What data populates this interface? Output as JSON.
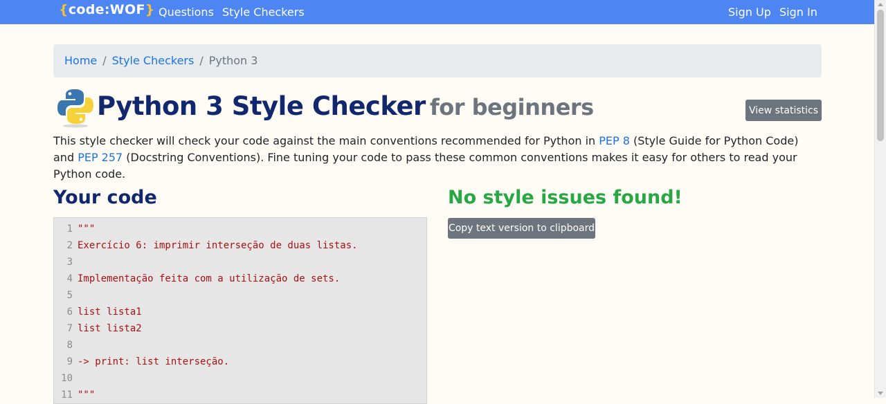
{
  "navbar": {
    "brand": {
      "open": "{",
      "name": "code:WOF",
      "close": "}"
    },
    "links": [
      "Questions",
      "Style Checkers"
    ],
    "auth": [
      "Sign Up",
      "Sign In"
    ]
  },
  "breadcrumb": {
    "home": "Home",
    "section": "Style Checkers",
    "current": "Python 3",
    "separator": "/"
  },
  "page": {
    "title": "Python 3 Style Checker",
    "subtitle": "for beginners",
    "stats_button": "View statistics",
    "intro_part1": "This style checker will check your code against the main conventions recommended for Python in ",
    "pep8_link": "PEP 8",
    "intro_part2": " (Style Guide for Python Code) and ",
    "pep257_link": "PEP 257",
    "intro_part3": " (Docstring Conventions). Fine tuning your code to pass these common conventions makes it easy for others to read your Python code."
  },
  "code_section": {
    "heading": "Your code",
    "lines": [
      {
        "n": "1",
        "text": "\"\"\""
      },
      {
        "n": "2",
        "text": "Exercício 6: imprimir interseção de duas listas."
      },
      {
        "n": "3",
        "text": ""
      },
      {
        "n": "4",
        "text": "Implementação feita com a utilização de sets."
      },
      {
        "n": "5",
        "text": ""
      },
      {
        "n": "6",
        "text": "list lista1"
      },
      {
        "n": "7",
        "text": "list lista2"
      },
      {
        "n": "8",
        "text": ""
      },
      {
        "n": "9",
        "text": "-> print: list interseção."
      },
      {
        "n": "10",
        "text": ""
      },
      {
        "n": "11",
        "text": "\"\"\""
      }
    ]
  },
  "result": {
    "heading": "No style issues found!",
    "copy_button": "Copy text version to clipboard"
  },
  "colors": {
    "navbar": "#4d86f2",
    "title": "#12286e",
    "success": "#28a745",
    "link": "#1a73e8",
    "button": "#6c757d"
  }
}
